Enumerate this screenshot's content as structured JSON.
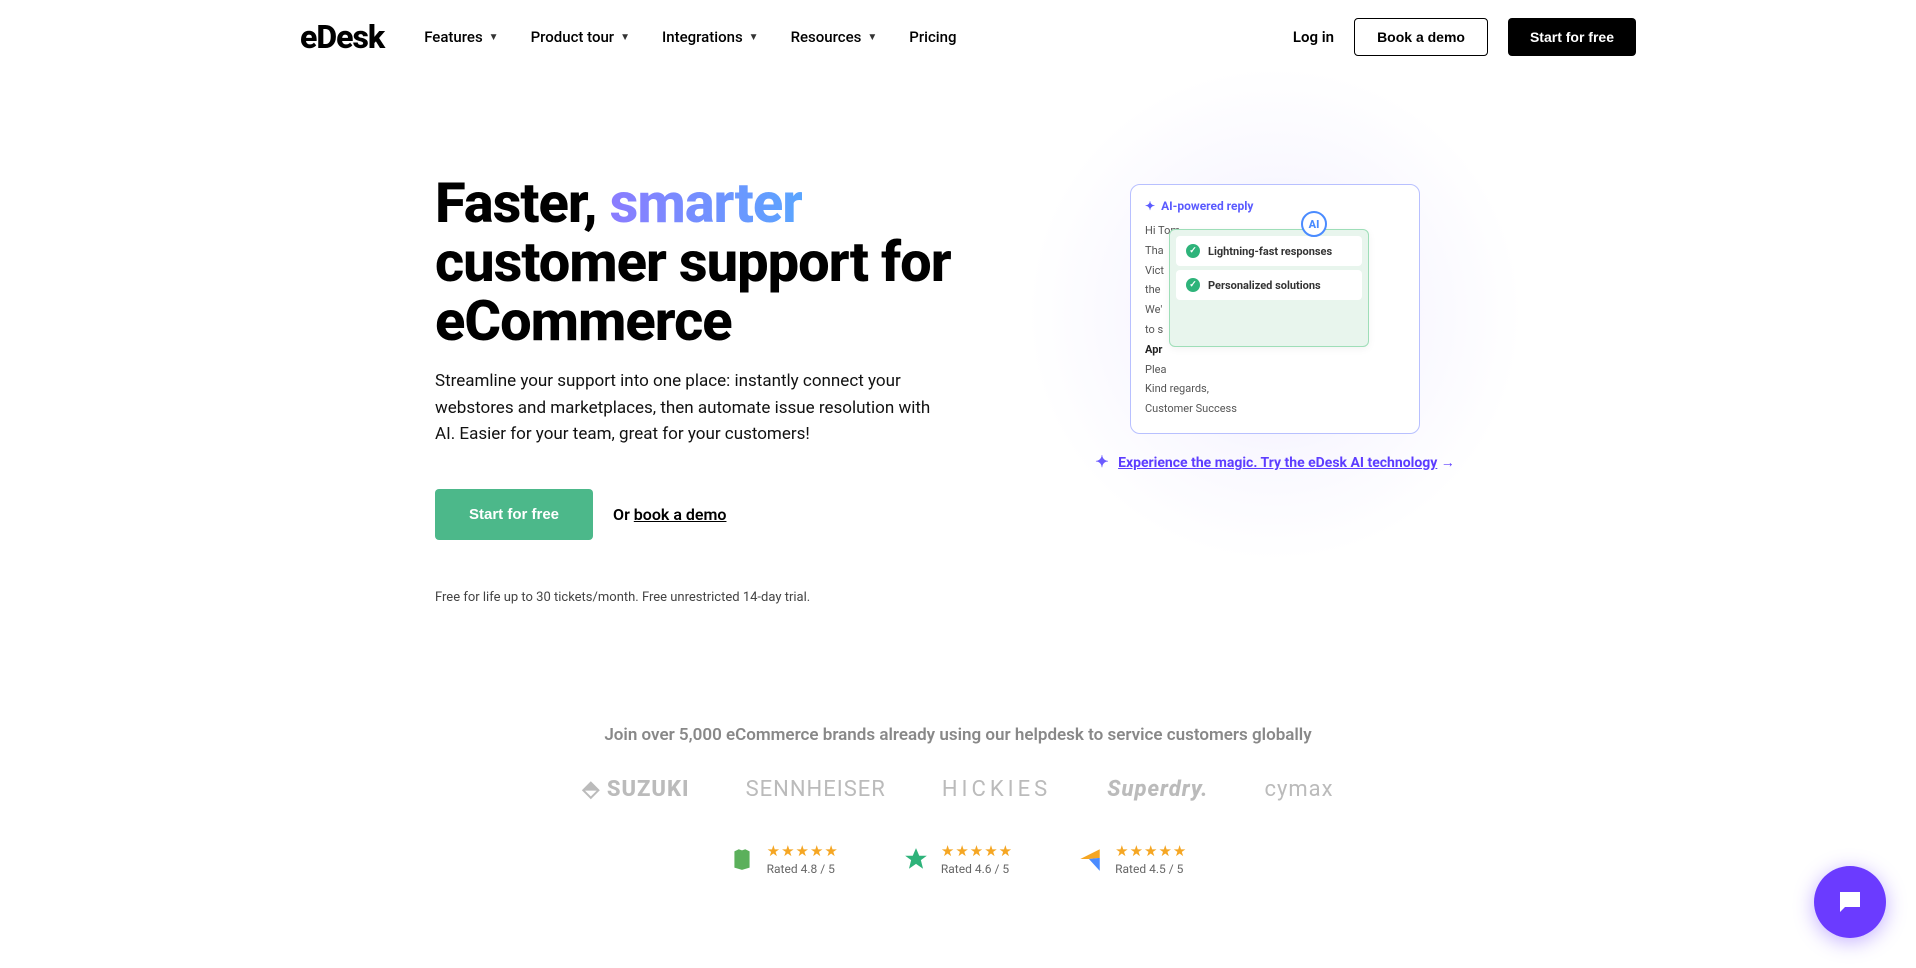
{
  "brand": "eDesk",
  "nav": {
    "items": [
      {
        "label": "Features",
        "dropdown": true
      },
      {
        "label": "Product tour",
        "dropdown": true
      },
      {
        "label": "Integrations",
        "dropdown": true
      },
      {
        "label": "Resources",
        "dropdown": true
      },
      {
        "label": "Pricing",
        "dropdown": false
      }
    ]
  },
  "header": {
    "login": "Log in",
    "book_demo": "Book a demo",
    "start_free": "Start for free"
  },
  "hero": {
    "title_pre": "Faster, ",
    "title_smart": "smarter",
    "title_post": "customer support for eCommerce",
    "subtitle": "Streamline your support into one place: instantly connect your webstores and marketplaces, then automate issue resolution with AI. Easier for your team, great for your customers!",
    "cta_primary": "Start for free",
    "cta_or": "Or ",
    "cta_book": "book a demo",
    "note": "Free for life up to 30 tickets/month. Free unrestricted 14-day trial."
  },
  "card": {
    "header": "AI-powered reply",
    "ai_badge": "AI",
    "greeting": "Hi Tom,",
    "line1": "Tha",
    "line2": "Vict",
    "line3": "the",
    "line4": "We'",
    "line5": "to s",
    "line_bold": "Apr",
    "line6": "Plea",
    "signoff1": "Kind regards,",
    "signoff2": "Customer Success",
    "popup": {
      "item1": "Lightning-fast responses",
      "item2": "Personalized solutions"
    }
  },
  "magic": {
    "text": "Experience the magic. Try the eDesk AI technology",
    "arrow": "→"
  },
  "proof": {
    "title": "Join over 5,000 eCommerce brands already using our helpdesk to service customers globally",
    "brands": [
      "SUZUKI",
      "SENNHEISER",
      "HICKIES",
      "Superdry.",
      "cymax"
    ]
  },
  "ratings": [
    {
      "icon": "shopify",
      "stars": "★★★★★",
      "text": "Rated 4.8 / 5"
    },
    {
      "icon": "trustpilot",
      "stars": "★★★★★",
      "text": "Rated 4.6 / 5"
    },
    {
      "icon": "capterra",
      "stars": "★★★★★",
      "text": "Rated 4.5 / 5"
    }
  ]
}
